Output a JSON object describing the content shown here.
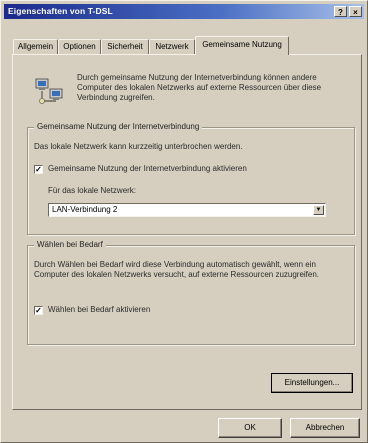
{
  "window": {
    "title": "Eigenschaften von T-DSL",
    "help_label": "?",
    "close_label": "×"
  },
  "tabs": [
    {
      "label": "Allgemein",
      "active": false
    },
    {
      "label": "Optionen",
      "active": false
    },
    {
      "label": "Sicherheit",
      "active": false
    },
    {
      "label": "Netzwerk",
      "active": false
    },
    {
      "label": "Gemeinsame Nutzung",
      "active": true
    }
  ],
  "intro": {
    "icon": "network-computers-icon",
    "text": "Durch gemeinsame Nutzung der Internetverbindung können andere Computer des lokalen Netzwerks auf externe Ressourcen über diese Verbindung zugreifen."
  },
  "sharing_group": {
    "title": "Gemeinsame Nutzung der Internetverbindung",
    "note": "Das lokale Netzwerk kann kurzzeitig unterbrochen werden.",
    "checkbox_label": "Gemeinsame Nutzung der Internetverbindung aktivieren",
    "checkbox_checked": true,
    "select_label": "Für das lokale Netzwerk:",
    "select_value": "LAN-Verbindung 2"
  },
  "dial_group": {
    "title": "Wählen bei Bedarf",
    "description": "Durch Wählen bei Bedarf wird diese Verbindung automatisch gewählt, wenn ein Computer des lokalen Netzwerks versucht, auf externe Ressourcen zuzugreifen.",
    "checkbox_label": "Wählen bei Bedarf aktivieren",
    "checkbox_checked": true
  },
  "buttons": {
    "settings": "Einstellungen...",
    "ok": "OK",
    "cancel": "Abbrechen"
  },
  "colors": {
    "titlebar_start": "#1b2a8c",
    "titlebar_end": "#a8c0e8",
    "face": "#d6cfc0"
  }
}
